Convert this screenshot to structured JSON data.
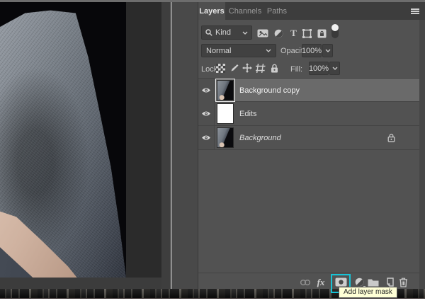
{
  "tabs": {
    "layers": "Layers",
    "channels": "Channels",
    "paths": "Paths"
  },
  "filter": {
    "kind": "Kind",
    "type_glyph": "T"
  },
  "blend": {
    "mode": "Normal",
    "opacity_label": "Opacity:",
    "opacity_value": "100%"
  },
  "lock": {
    "label": "Lock:",
    "fill_label": "Fill:",
    "fill_value": "100%"
  },
  "layers": [
    {
      "name": "Background copy",
      "selected": true,
      "visible": true
    },
    {
      "name": "Edits",
      "selected": false,
      "visible": true
    },
    {
      "name": "Background",
      "selected": false,
      "visible": true,
      "locked": true,
      "italic": true
    }
  ],
  "bottom": {
    "fx": "fx"
  },
  "tooltip": {
    "text": "Add layer mask"
  },
  "icons": {
    "filter_row": [
      "pixel-filter-icon",
      "adjustment-filter-icon",
      "type-filter-icon",
      "shape-filter-icon",
      "smart-object-filter-icon",
      "filter-toggle"
    ],
    "lock_row": [
      "lock-transparency-icon",
      "lock-pixels-icon",
      "lock-position-icon",
      "lock-artboard-icon",
      "lock-all-icon"
    ],
    "bottom_bar": [
      "link-layers-icon",
      "layer-style-icon",
      "add-layer-mask-icon",
      "new-adjustment-layer-icon",
      "new-group-icon",
      "new-layer-icon",
      "delete-layer-icon"
    ]
  },
  "colors": {
    "highlight": "#17c3d6",
    "tooltip_bg": "#ffffd6",
    "panel_bg": "#525252",
    "selected_row": "#6a6a6a",
    "tab_bar": "#3d3d3d"
  }
}
